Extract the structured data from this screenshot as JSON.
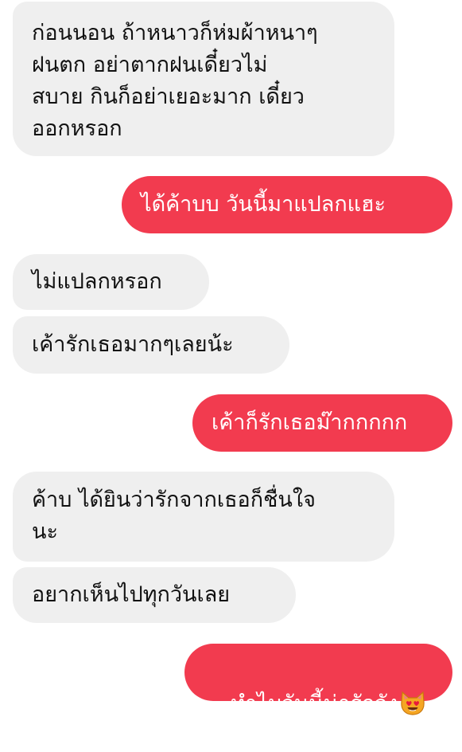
{
  "messages": [
    {
      "direction": "incoming",
      "text": "ก่อนนอน ถ้าหนาวก็ห่มผ้าหนาๆ\nฝนตก อย่าตากฝนเดี๋ยวไม่\nสบาย กินก็อย่าเยอะมาก เดี๋ยว\nออกหรอก"
    },
    {
      "direction": "outgoing",
      "text": "ได้ค้าบบ วันนี้มาแปลกแฮะ"
    },
    {
      "direction": "incoming",
      "text": "ไม่แปลกหรอก"
    },
    {
      "direction": "incoming",
      "text": "เค้ารักเธอมากๆเลยน้ะ"
    },
    {
      "direction": "outgoing",
      "text": "เค้าก็รักเธอม๊ากกกกก"
    },
    {
      "direction": "incoming",
      "text": "ค้าบ ได้ยินว่ารักจากเธอก็ชื่นใจ\nนะ"
    },
    {
      "direction": "incoming",
      "text": "อยากเห็นไปทุกวันเลย"
    },
    {
      "direction": "outgoing",
      "text": "ทำไมวันนี้น่ารักจัง",
      "emoji": "heart-eyes-cat-icon"
    }
  ],
  "colors": {
    "incoming_bubble": "#efefef",
    "outgoing_bubble": "#f23b4f",
    "incoming_text": "#111111",
    "outgoing_text": "#ffffff"
  }
}
